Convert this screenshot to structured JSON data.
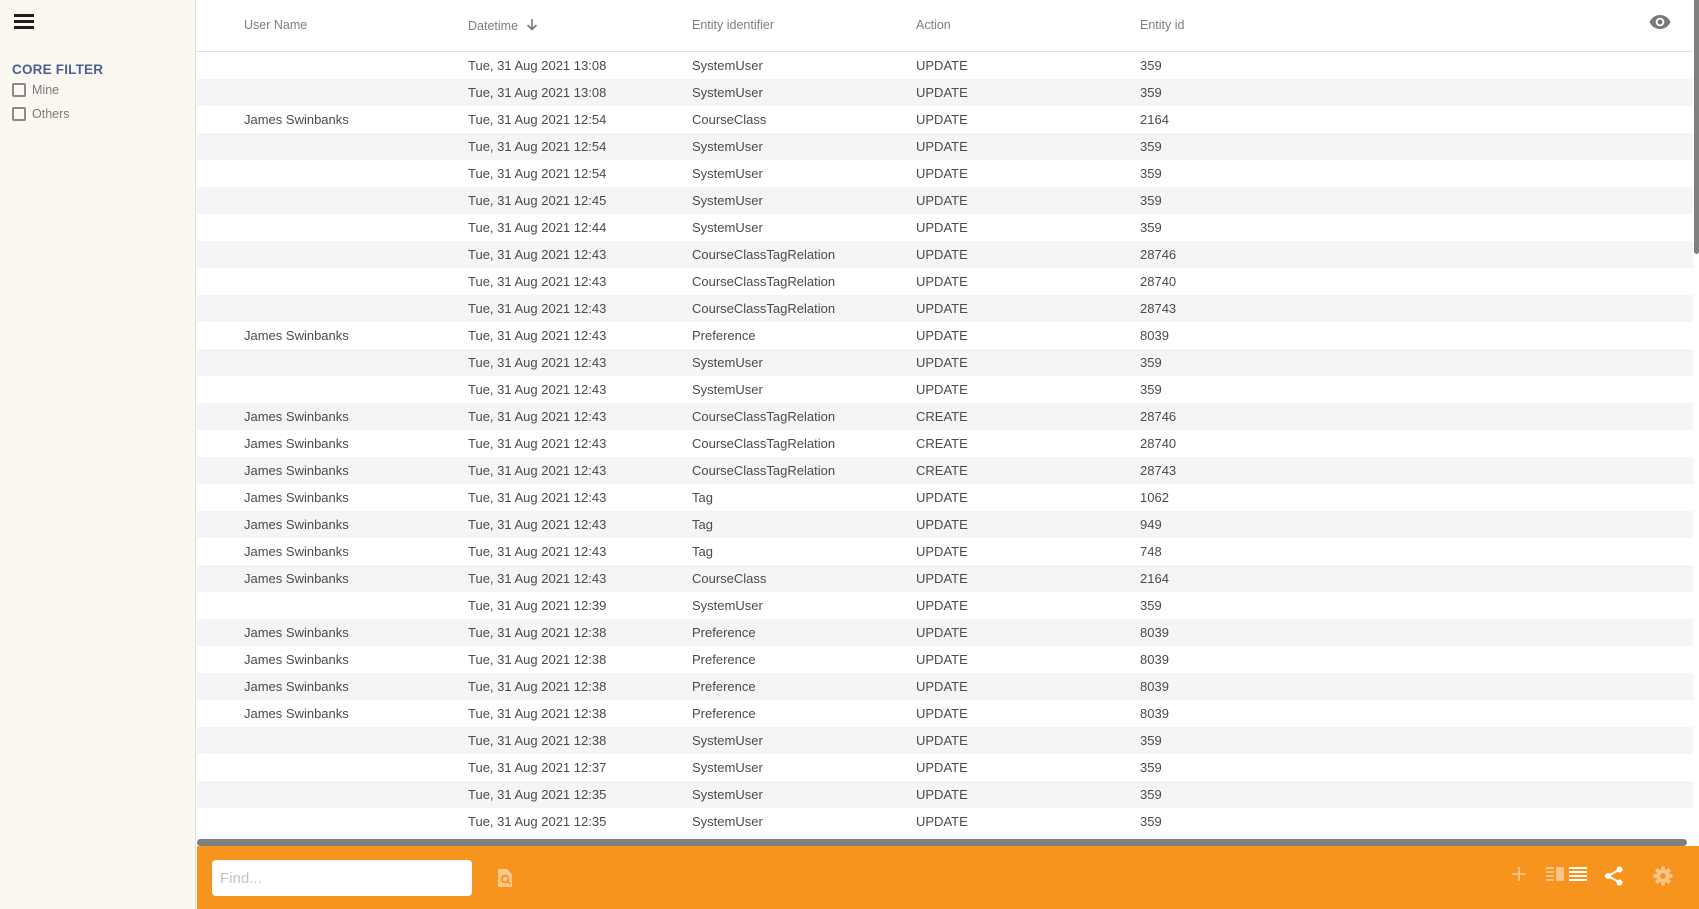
{
  "sidebar": {
    "menu_icon": "hamburger-menu-icon",
    "filter_title": "CORE FILTER",
    "filters": [
      {
        "label": "Mine",
        "checked": false
      },
      {
        "label": "Others",
        "checked": false
      }
    ]
  },
  "table": {
    "columns": [
      "User Name",
      "Datetime",
      "Entity identifier",
      "Action",
      "Entity id"
    ],
    "sort_column": "Datetime",
    "sort_direction": "descending",
    "visibility_icon": "eye-icon",
    "rows": [
      [
        "",
        "Tue, 31 Aug 2021 13:08",
        "SystemUser",
        "UPDATE",
        "359"
      ],
      [
        "",
        "Tue, 31 Aug 2021 13:08",
        "SystemUser",
        "UPDATE",
        "359"
      ],
      [
        "James Swinbanks",
        "Tue, 31 Aug 2021 12:54",
        "CourseClass",
        "UPDATE",
        "2164"
      ],
      [
        "",
        "Tue, 31 Aug 2021 12:54",
        "SystemUser",
        "UPDATE",
        "359"
      ],
      [
        "",
        "Tue, 31 Aug 2021 12:54",
        "SystemUser",
        "UPDATE",
        "359"
      ],
      [
        "",
        "Tue, 31 Aug 2021 12:45",
        "SystemUser",
        "UPDATE",
        "359"
      ],
      [
        "",
        "Tue, 31 Aug 2021 12:44",
        "SystemUser",
        "UPDATE",
        "359"
      ],
      [
        "",
        "Tue, 31 Aug 2021 12:43",
        "CourseClassTagRelation",
        "UPDATE",
        "28746"
      ],
      [
        "",
        "Tue, 31 Aug 2021 12:43",
        "CourseClassTagRelation",
        "UPDATE",
        "28740"
      ],
      [
        "",
        "Tue, 31 Aug 2021 12:43",
        "CourseClassTagRelation",
        "UPDATE",
        "28743"
      ],
      [
        "James Swinbanks",
        "Tue, 31 Aug 2021 12:43",
        "Preference",
        "UPDATE",
        "8039"
      ],
      [
        "",
        "Tue, 31 Aug 2021 12:43",
        "SystemUser",
        "UPDATE",
        "359"
      ],
      [
        "",
        "Tue, 31 Aug 2021 12:43",
        "SystemUser",
        "UPDATE",
        "359"
      ],
      [
        "James Swinbanks",
        "Tue, 31 Aug 2021 12:43",
        "CourseClassTagRelation",
        "CREATE",
        "28746"
      ],
      [
        "James Swinbanks",
        "Tue, 31 Aug 2021 12:43",
        "CourseClassTagRelation",
        "CREATE",
        "28740"
      ],
      [
        "James Swinbanks",
        "Tue, 31 Aug 2021 12:43",
        "CourseClassTagRelation",
        "CREATE",
        "28743"
      ],
      [
        "James Swinbanks",
        "Tue, 31 Aug 2021 12:43",
        "Tag",
        "UPDATE",
        "1062"
      ],
      [
        "James Swinbanks",
        "Tue, 31 Aug 2021 12:43",
        "Tag",
        "UPDATE",
        "949"
      ],
      [
        "James Swinbanks",
        "Tue, 31 Aug 2021 12:43",
        "Tag",
        "UPDATE",
        "748"
      ],
      [
        "James Swinbanks",
        "Tue, 31 Aug 2021 12:43",
        "CourseClass",
        "UPDATE",
        "2164"
      ],
      [
        "",
        "Tue, 31 Aug 2021 12:39",
        "SystemUser",
        "UPDATE",
        "359"
      ],
      [
        "James Swinbanks",
        "Tue, 31 Aug 2021 12:38",
        "Preference",
        "UPDATE",
        "8039"
      ],
      [
        "James Swinbanks",
        "Tue, 31 Aug 2021 12:38",
        "Preference",
        "UPDATE",
        "8039"
      ],
      [
        "James Swinbanks",
        "Tue, 31 Aug 2021 12:38",
        "Preference",
        "UPDATE",
        "8039"
      ],
      [
        "James Swinbanks",
        "Tue, 31 Aug 2021 12:38",
        "Preference",
        "UPDATE",
        "8039"
      ],
      [
        "",
        "Tue, 31 Aug 2021 12:38",
        "SystemUser",
        "UPDATE",
        "359"
      ],
      [
        "",
        "Tue, 31 Aug 2021 12:37",
        "SystemUser",
        "UPDATE",
        "359"
      ],
      [
        "",
        "Tue, 31 Aug 2021 12:35",
        "SystemUser",
        "UPDATE",
        "359"
      ],
      [
        "",
        "Tue, 31 Aug 2021 12:35",
        "SystemUser",
        "UPDATE",
        "359"
      ]
    ]
  },
  "toolbar": {
    "find_placeholder": "Find...",
    "find_value": "",
    "icons": [
      "search-document-icon",
      "plus-icon",
      "split-view-icon",
      "list-view-icon",
      "share-icon",
      "gear-icon"
    ]
  },
  "colors": {
    "toolbar_bg": "#f7941d",
    "sidebar_bg": "#fbf8f1",
    "filter_title": "#4a6191",
    "row_stripe": "#f5f5f5"
  }
}
